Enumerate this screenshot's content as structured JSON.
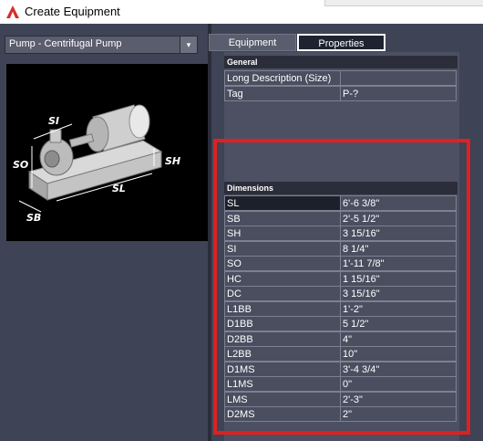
{
  "window": {
    "title": "Create Equipment"
  },
  "left": {
    "equipment_type": "Pump - Centrifugal Pump"
  },
  "preview": {
    "labels": {
      "si": "SI",
      "so": "SO",
      "sh": "SH",
      "sl": "SL",
      "sb": "SB"
    }
  },
  "tabs": [
    {
      "label": "Equipment"
    },
    {
      "label": "Properties"
    }
  ],
  "general": {
    "header": "General",
    "rows": [
      {
        "name": "Long Description (Size)",
        "value": ""
      },
      {
        "name": "Tag",
        "value": "P-?"
      }
    ]
  },
  "dimensions": {
    "header": "Dimensions",
    "rows": [
      {
        "name": "SL",
        "value": "6'-6 3/8\""
      },
      {
        "name": "SB",
        "value": "2'-5 1/2\""
      },
      {
        "name": "SH",
        "value": "3 15/16\""
      },
      {
        "name": "SI",
        "value": "8 1/4\""
      },
      {
        "name": "SO",
        "value": "1'-11 7/8\""
      },
      {
        "name": "HC",
        "value": "1 15/16\""
      },
      {
        "name": "DC",
        "value": "3 15/16\""
      },
      {
        "name": "L1BB",
        "value": "1'-2\""
      },
      {
        "name": "D1BB",
        "value": "5 1/2\""
      },
      {
        "name": "D2BB",
        "value": "4\""
      },
      {
        "name": "L2BB",
        "value": "10\""
      },
      {
        "name": "D1MS",
        "value": "3'-4 3/4\""
      },
      {
        "name": "L1MS",
        "value": "0\""
      },
      {
        "name": "LMS",
        "value": "2'-3\""
      },
      {
        "name": "D2MS",
        "value": "2\""
      }
    ]
  },
  "colors": {
    "highlight": "#e02020",
    "app_icon": "#d32f2f"
  }
}
